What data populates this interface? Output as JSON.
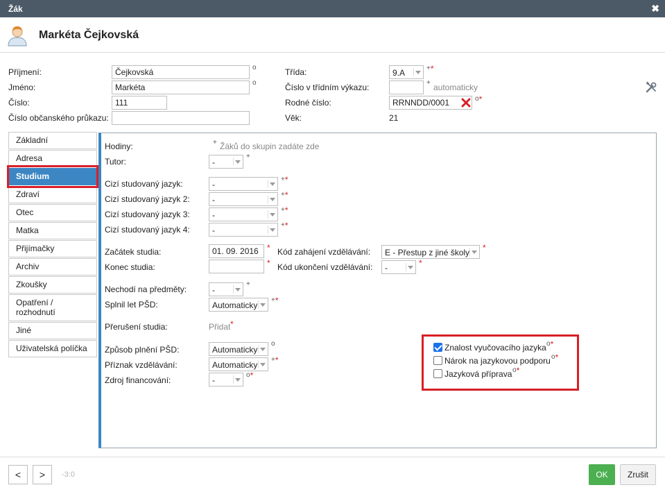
{
  "window": {
    "title": "Žák",
    "close_glyph": "✖"
  },
  "student": {
    "name": "Markéta Čejkovská"
  },
  "header_fields": {
    "prijmeni_label": "Příjmení:",
    "prijmeni_value": "Čejkovská",
    "jmeno_label": "Jméno:",
    "jmeno_value": "Markéta",
    "cislo_label": "Číslo:",
    "cislo_value": "111",
    "op_label": "Číslo občanského průkazu:",
    "op_value": "",
    "trida_label": "Třída:",
    "trida_value": "9.A",
    "vykaz_label": "Číslo v třídním výkazu:",
    "vykaz_value": "",
    "vykaz_hint": "automaticky",
    "rc_label": "Rodné číslo:",
    "rc_value": "RRNNDD/0001",
    "vek_label": "Věk:",
    "vek_value": "21"
  },
  "tabs": [
    {
      "label": "Základní"
    },
    {
      "label": "Adresa"
    },
    {
      "label": "Studium"
    },
    {
      "label": "Zdraví"
    },
    {
      "label": "Otec"
    },
    {
      "label": "Matka"
    },
    {
      "label": "Přijímačky"
    },
    {
      "label": "Archiv"
    },
    {
      "label": "Zkoušky"
    },
    {
      "label": "Opatření / rozhodnutí"
    },
    {
      "label": "Jiné"
    },
    {
      "label": "Uživatelská políčka"
    }
  ],
  "active_tab": "Studium",
  "study": {
    "hodiny_label": "Hodiny:",
    "hodiny_hint": "Žáků do skupin zadáte zde",
    "tutor_label": "Tutor:",
    "tutor_value": "-",
    "jazyk1_label": "Cizí studovaný jazyk:",
    "jazyk1_value": "-",
    "jazyk2_label": "Cizí studovaný jazyk 2:",
    "jazyk2_value": "-",
    "jazyk3_label": "Cizí studovaný jazyk 3:",
    "jazyk3_value": "-",
    "jazyk4_label": "Cizí studovaný jazyk 4:",
    "jazyk4_value": "-",
    "zacatek_label": "Začátek studia:",
    "zacatek_value": "01. 09. 2016",
    "konec_label": "Konec studia:",
    "konec_value": "",
    "kod_zahajeni_label": "Kód zahájení vzdělávání:",
    "kod_zahajeni_value": "E - Přestup z jiné školy",
    "kod_ukonceni_label": "Kód ukončení vzdělávání:",
    "kod_ukonceni_value": "-",
    "nechodi_label": "Nechodí na předměty:",
    "nechodi_value": "-",
    "splnil_label": "Splnil let PŠD:",
    "splnil_value": "Automaticky",
    "preruseni_label": "Přerušení studia:",
    "preruseni_link": "Přidat",
    "zpusob_label": "Způsob plnění PŠD:",
    "zpusob_value": "Automaticky",
    "priznak_label": "Příznak vzdělávání:",
    "priznak_value": "Automaticky",
    "zdroj_label": "Zdroj financování:",
    "zdroj_value": "-"
  },
  "checkboxes": [
    {
      "label": "Znalost vyučovacího jazyka",
      "checked": true
    },
    {
      "label": "Nárok na jazykovou podporu",
      "checked": false
    },
    {
      "label": "Jazyková příprava",
      "checked": false
    }
  ],
  "footer": {
    "prev": "<",
    "next": ">",
    "counter": "-3:0",
    "ok": "OK",
    "cancel": "Zrušit"
  },
  "colors": {
    "titlebar": "#4c5a68",
    "active_tab": "#3c86c4",
    "highlight": "#d81f26",
    "ok": "#4caf50"
  },
  "icons": {
    "avatar": "user-avatar-icon",
    "tools": "tools-icon",
    "delete": "delete-x-icon"
  }
}
